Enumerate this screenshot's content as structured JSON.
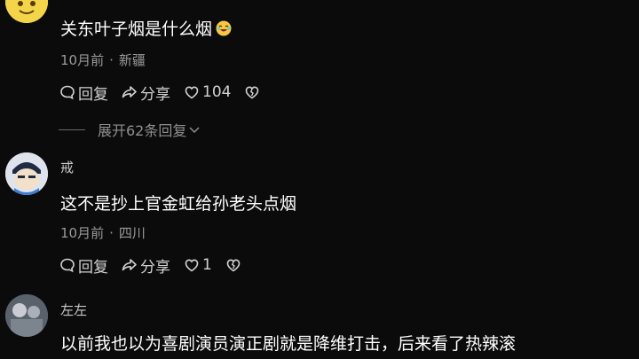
{
  "comments": [
    {
      "username": "",
      "text": "关东叶子烟是什么烟",
      "emoji": "laughing-tears-emoji",
      "time": "10月前",
      "location": "新疆",
      "reply_label": "回复",
      "share_label": "分享",
      "likes": "104"
    },
    {
      "username": "戒",
      "text": "这不是抄上官金虹给孙老头点烟",
      "time": "10月前",
      "location": "四川",
      "reply_label": "回复",
      "share_label": "分享",
      "likes": "1"
    },
    {
      "username": "左左",
      "text": "以前我也以为喜剧演员演正剧就是降维打击，后来看了热辣滚"
    }
  ],
  "expand_replies": "展开62条回复",
  "colors": {
    "background": "#0b0b0c",
    "text": "#ffffff",
    "meta": "#9a9a9a",
    "action": "#d2d2d2"
  }
}
